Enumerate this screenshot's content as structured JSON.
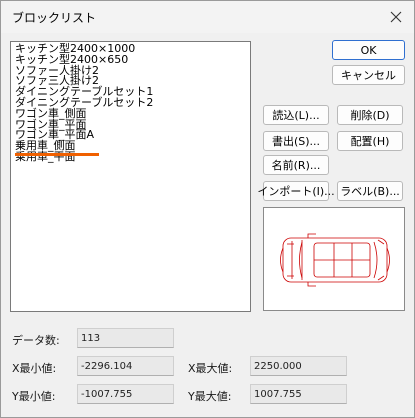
{
  "window": {
    "title": "ブロックリスト"
  },
  "blocks": [
    "キッチン型2400×1000",
    "キッチン型2400×650",
    "ソファー人掛け2",
    "ソファ三人掛け2",
    "ダイニングテーブルセット1",
    "ダイニングテーブルセット2",
    "ワゴン車_側面",
    "ワゴン車_平面",
    "ワゴン車_平面A",
    "乗用車_側面",
    "乗用車_平面"
  ],
  "buttons": {
    "ok": "OK",
    "cancel": "キャンセル",
    "read": "読込(L)...",
    "delete": "削除(D)",
    "write": "書出(S)...",
    "place": "配置(H)",
    "rename": "名前(R)...",
    "import": "インポート(I)...",
    "label": "ラベル(B)..."
  },
  "info": {
    "data_count_label": "データ数:",
    "data_count": "113",
    "x_min_label": "X最小値:",
    "x_min": "-2296.104",
    "x_max_label": "X最大値:",
    "x_max": "2250.000",
    "y_min_label": "Y最小値:",
    "y_min": "-1007.755",
    "y_max_label": "Y最大値:",
    "y_max": "1007.755"
  },
  "colors": {
    "highlight_underline": "#f06000",
    "preview_stroke": "#cc0000"
  },
  "icons": {
    "close": "close-icon"
  }
}
